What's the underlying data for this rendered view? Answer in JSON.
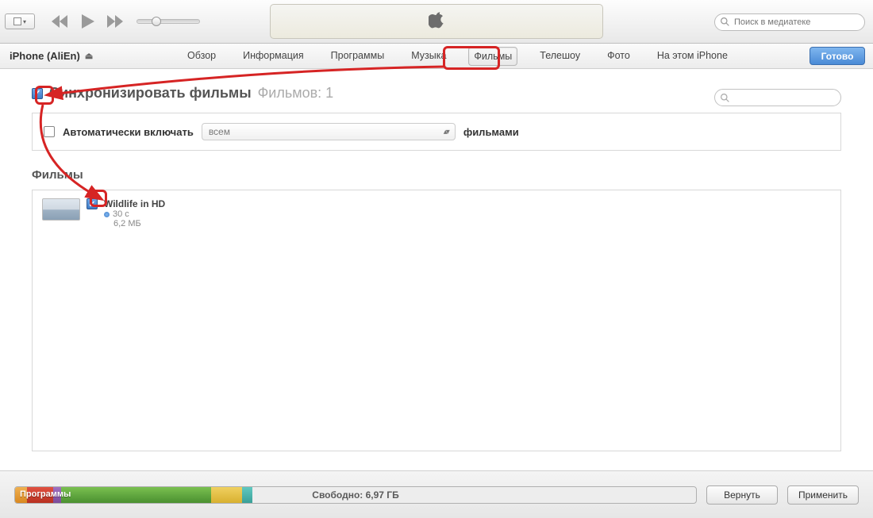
{
  "search": {
    "placeholder": "Поиск в медиатеке"
  },
  "device": {
    "name": "iPhone (AliEn)"
  },
  "tabs": {
    "items": [
      {
        "label": "Обзор"
      },
      {
        "label": "Информация"
      },
      {
        "label": "Программы"
      },
      {
        "label": "Музыка"
      },
      {
        "label": "Фильмы"
      },
      {
        "label": "Телешоу"
      },
      {
        "label": "Фото"
      },
      {
        "label": "На этом iPhone"
      }
    ],
    "active_index": 4,
    "done": "Готово"
  },
  "sync": {
    "title": "Синхронизировать фильмы",
    "count_label": "Фильмов: 1",
    "auto_label": "Автоматически включать",
    "select_value": "всем",
    "films_word": "фильмами"
  },
  "section": {
    "title": "Фильмы"
  },
  "films": [
    {
      "name": "Wildlife in HD",
      "duration": "30 с",
      "size": "6,2 МБ"
    }
  ],
  "capacity": {
    "segment_label": "Программы",
    "free_label": "Свободно: 6,97 ГБ"
  },
  "buttons": {
    "revert": "Вернуть",
    "apply": "Применить"
  }
}
